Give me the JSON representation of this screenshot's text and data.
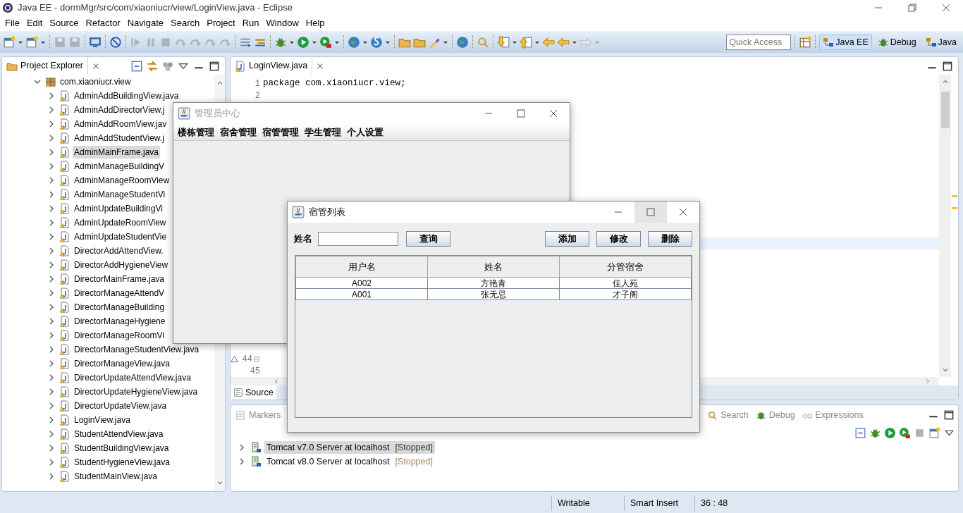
{
  "window": {
    "title": "Java EE - dormMgr/src/com/xiaoniucr/view/LoginView.java - Eclipse"
  },
  "menu": [
    "File",
    "Edit",
    "Source",
    "Refactor",
    "Navigate",
    "Search",
    "Project",
    "Run",
    "Window",
    "Help"
  ],
  "quick_access": {
    "placeholder": "Quick Access"
  },
  "perspectives": [
    {
      "label": "Java EE",
      "selected": true
    },
    {
      "label": "Debug",
      "selected": false
    },
    {
      "label": "Java",
      "selected": false
    }
  ],
  "project_explorer": {
    "title": "Project Explorer",
    "tree": [
      {
        "label": "com.xiaoniucr.view",
        "expanded": true,
        "children": [
          {
            "label": "AdminAddBuildingView.java",
            "selected": false
          },
          {
            "label": "AdminAddDirectorView.j",
            "selected": false
          },
          {
            "label": "AdminAddRoomView.jav",
            "selected": false
          },
          {
            "label": "AdminAddStudentView.j",
            "selected": false
          },
          {
            "label": "AdminMainFrame.java",
            "selected": true
          },
          {
            "label": "AdminManageBuildingV",
            "selected": false
          },
          {
            "label": "AdminManageRoomView",
            "selected": false
          },
          {
            "label": "AdminManageStudentVi",
            "selected": false
          },
          {
            "label": "AdminUpdateBuildingVi",
            "selected": false
          },
          {
            "label": "AdminUpdateRoomView",
            "selected": false
          },
          {
            "label": "AdminUpdateStudentVie",
            "selected": false
          },
          {
            "label": "DirectorAddAttendView.",
            "selected": false
          },
          {
            "label": "DirectorAddHygieneView",
            "selected": false
          },
          {
            "label": "DirectorMainFrame.java",
            "selected": false
          },
          {
            "label": "DirectorManageAttendV",
            "selected": false
          },
          {
            "label": "DirectorManageBuilding",
            "selected": false
          },
          {
            "label": "DirectorManageHygiene",
            "selected": false
          },
          {
            "label": "DirectorManageRoomVi",
            "selected": false
          },
          {
            "label": "DirectorManageStudentView.java",
            "selected": false
          },
          {
            "label": "DirectorManageView.java",
            "selected": false
          },
          {
            "label": "DirectorUpdateAttendView.java",
            "selected": false
          },
          {
            "label": "DirectorUpdateHygieneView.java",
            "selected": false
          },
          {
            "label": "DirectorUpdateView.java",
            "selected": false
          },
          {
            "label": "LoginView.java",
            "selected": false
          },
          {
            "label": "StudentAttendView.java",
            "selected": false
          },
          {
            "label": "StudentBuildingView.java",
            "selected": false
          },
          {
            "label": "StudentHygieneView.java",
            "selected": false
          },
          {
            "label": "StudentMainView.java",
            "selected": false
          }
        ]
      }
    ]
  },
  "editor": {
    "tab": "LoginView.java",
    "top_lines": [
      {
        "number": "1",
        "code": "package com.xiaoniucr.view;"
      },
      {
        "number": "2"
      }
    ],
    "bottom_lines": [
      {
        "number": "44"
      },
      {
        "number": "45"
      }
    ],
    "bottom_tab": "Source"
  },
  "bottom_panel": {
    "tabs": [
      "Markers",
      "Search",
      "Debug",
      "Expressions"
    ],
    "servers": [
      {
        "name": "Tomcat v7.0 Server at localhost",
        "status": "[Stopped]",
        "selected": true
      },
      {
        "name": "Tomcat v8.0 Server at localhost",
        "status": "[Stopped]",
        "selected": false
      }
    ]
  },
  "status_bar": [
    "Writable",
    "Smart Insert",
    "36 : 48"
  ],
  "admin_window": {
    "title": "管理员中心",
    "active": false,
    "menus": [
      "楼栋管理",
      "宿舍管理",
      "宿管管理",
      "学生管理",
      "个人设置"
    ]
  },
  "dialog": {
    "title": "宿管列表",
    "active": true,
    "search_label": "姓名",
    "query_button": "查询",
    "buttons": [
      "添加",
      "修改",
      "删除"
    ],
    "table": {
      "columns": [
        "用户名",
        "姓名",
        "分管宿舍"
      ],
      "rows": [
        [
          "A002",
          "方艳青",
          "佳人苑"
        ],
        [
          "A001",
          "张无忌",
          "才子阁"
        ]
      ]
    }
  }
}
